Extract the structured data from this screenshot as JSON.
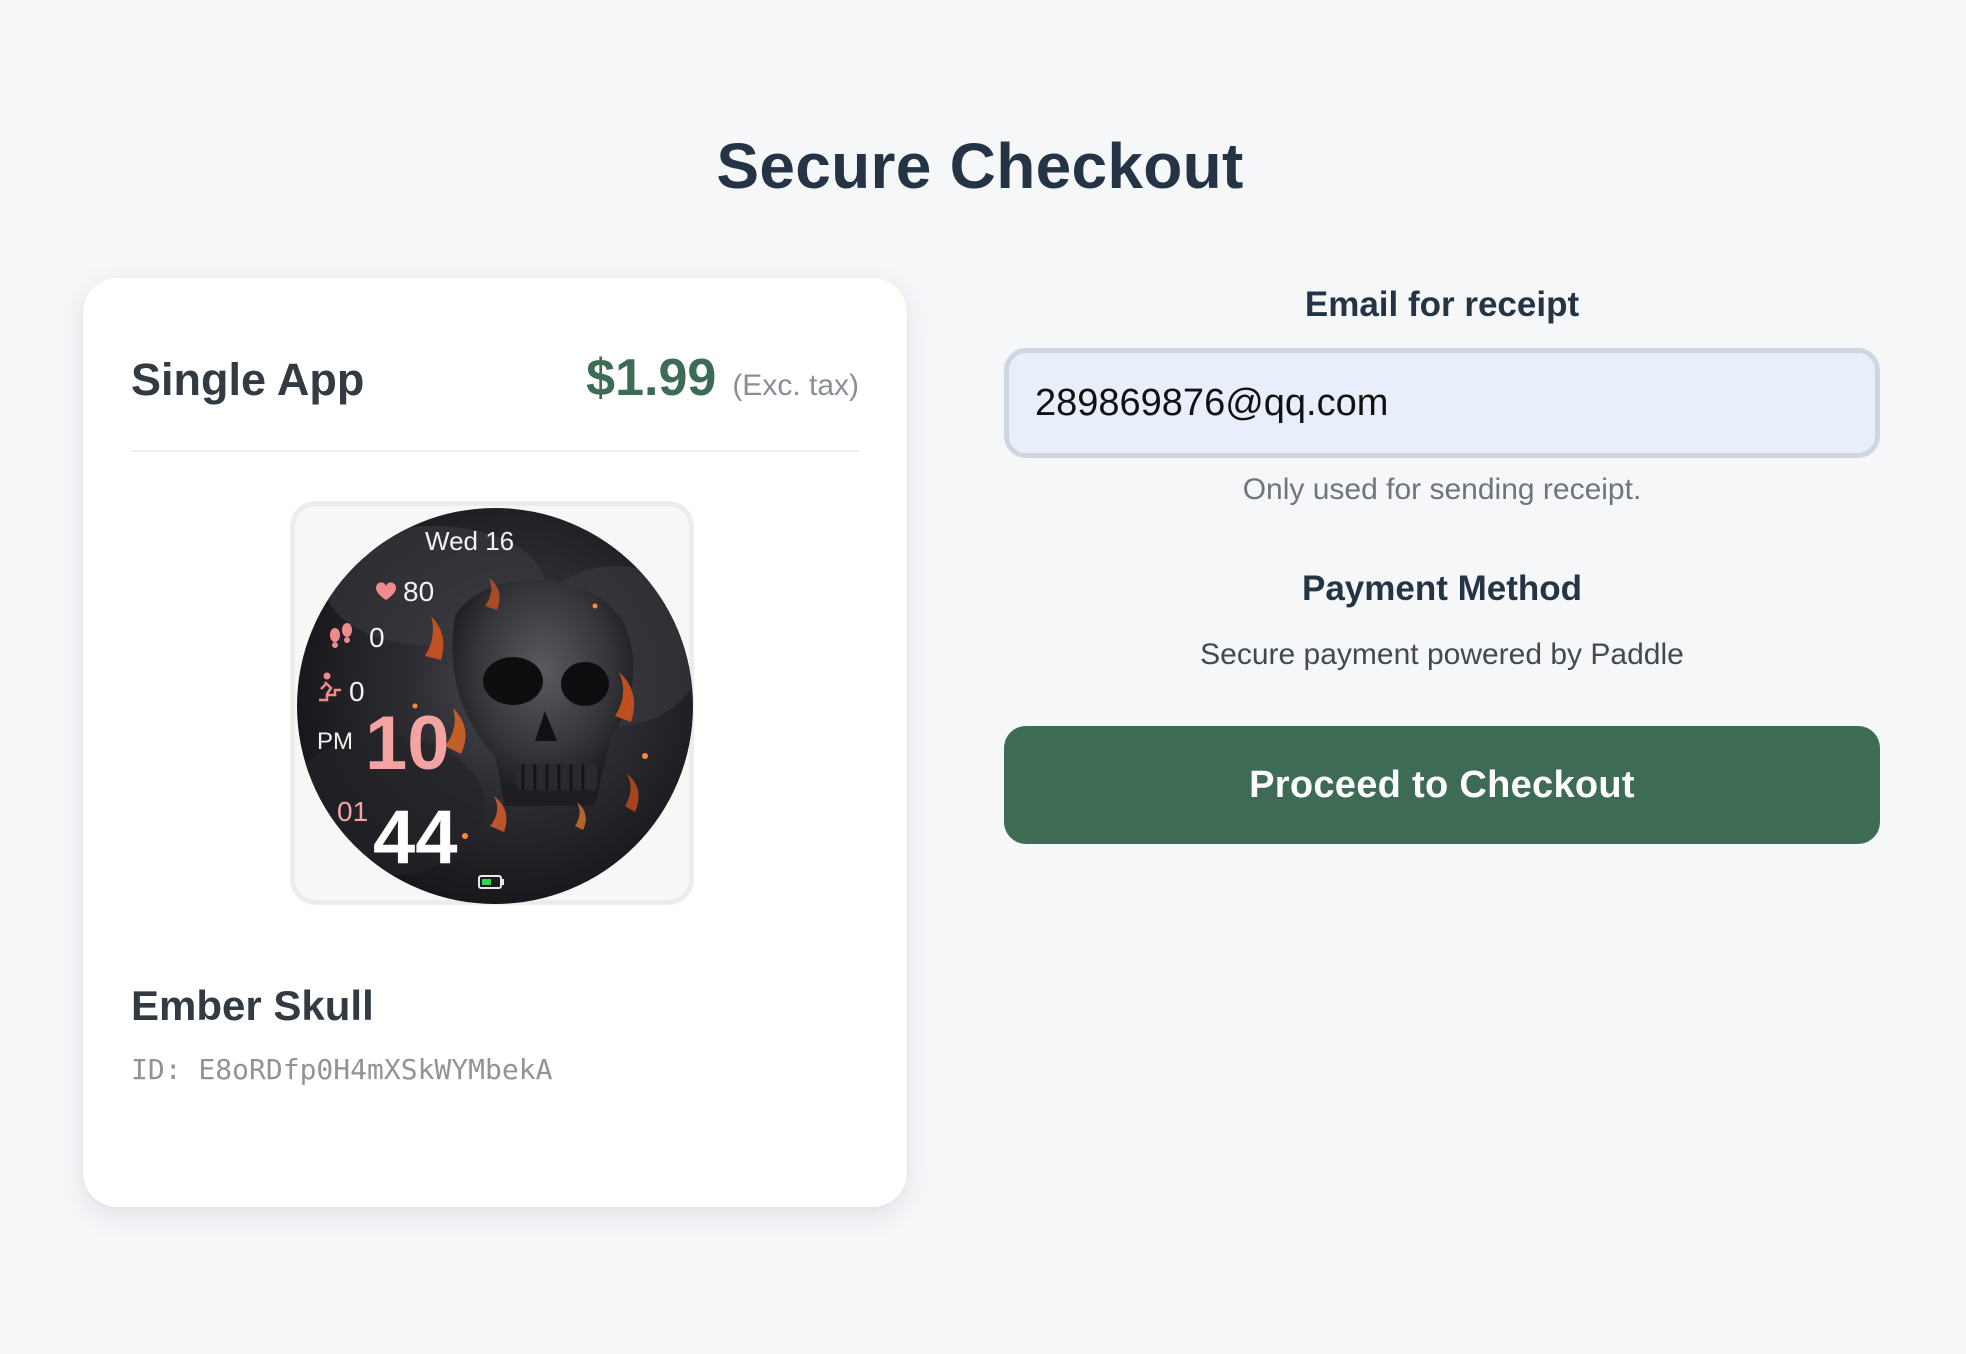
{
  "page": {
    "title": "Secure Checkout"
  },
  "product_card": {
    "plan_name": "Single App",
    "price": "$1.99",
    "tax_note": "(Exc. tax)",
    "product_name": "Ember Skull",
    "product_id": "ID: E8oRDfp0H4mXSkWYMbekA",
    "preview": {
      "date": "Wed 16",
      "heart_rate": "80",
      "steps": "0",
      "floors": "0",
      "ampm": "PM",
      "hour": "10",
      "seconds": "01",
      "minute": "44"
    }
  },
  "checkout_form": {
    "email_label": "Email for receipt",
    "email_value": "289869876@qq.com",
    "email_help": "Only used for sending receipt.",
    "payment_heading": "Payment Method",
    "payment_sub": "Secure payment powered by Paddle",
    "checkout_button": "Proceed to Checkout"
  },
  "colors": {
    "accent_green": "#3e6b53",
    "heading_navy": "#253445",
    "background": "#f6f7f9",
    "input_fill": "#e8effb"
  },
  "icons": [
    "heart-icon",
    "footsteps-icon",
    "stairs-climber-icon",
    "battery-icon"
  ]
}
